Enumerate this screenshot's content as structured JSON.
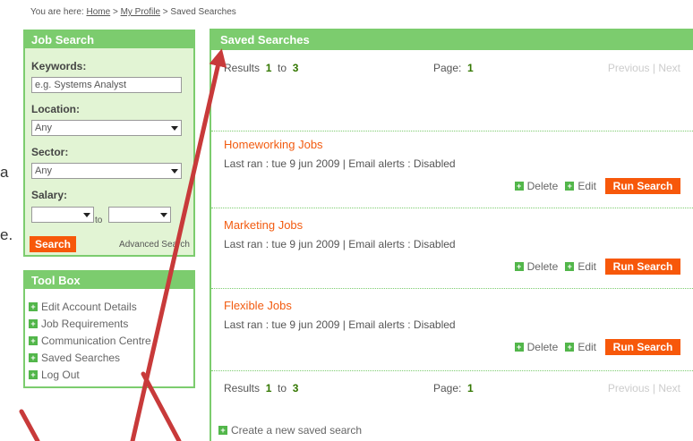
{
  "breadcrumb": {
    "prefix": "You are here:",
    "home": "Home",
    "sep1": ">",
    "profile": "My Profile",
    "sep2": ">",
    "current": "Saved Searches"
  },
  "stray_text": [
    "a",
    "e."
  ],
  "job_search": {
    "title": "Job Search",
    "keywords_label": "Keywords:",
    "keywords_placeholder": "e.g. Systems Analyst",
    "location_label": "Location:",
    "location_value": "Any",
    "sector_label": "Sector:",
    "sector_value": "Any",
    "salary_label": "Salary:",
    "salary_to": "to",
    "search_button": "Search",
    "advanced_link": "Advanced Search"
  },
  "tool_box": {
    "title": "Tool Box",
    "items": [
      "Edit Account Details",
      "Job Requirements",
      "Communication Centre",
      "Saved Searches",
      "Log Out"
    ]
  },
  "main": {
    "title": "Saved Searches",
    "results_label": "Results",
    "results_from": "1",
    "results_to_word": "to",
    "results_to": "3",
    "page_label": "Page:",
    "page_number": "1",
    "previous": "Previous",
    "pager_sep": "|",
    "next": "Next",
    "delete_label": "Delete",
    "edit_label": "Edit",
    "run_label": "Run Search",
    "searches": [
      {
        "title": "Homeworking Jobs",
        "meta": "Last ran : tue 9 jun 2009 | Email alerts : Disabled"
      },
      {
        "title": "Marketing Jobs",
        "meta": "Last ran : tue 9 jun 2009 | Email alerts : Disabled"
      },
      {
        "title": "Flexible Jobs",
        "meta": "Last ran : tue 9 jun 2009 | Email alerts : Disabled"
      }
    ],
    "create_link": "Create a new saved search"
  },
  "colors": {
    "panel_green": "#7ccc6e",
    "panel_bg": "#e2f4d4",
    "accent_orange": "#f7580a",
    "title_orange": "#f25b10",
    "arrow_red": "#c83a3a"
  },
  "icons": {
    "plus": "plus-square-icon",
    "dropdown": "chevron-down-icon"
  }
}
